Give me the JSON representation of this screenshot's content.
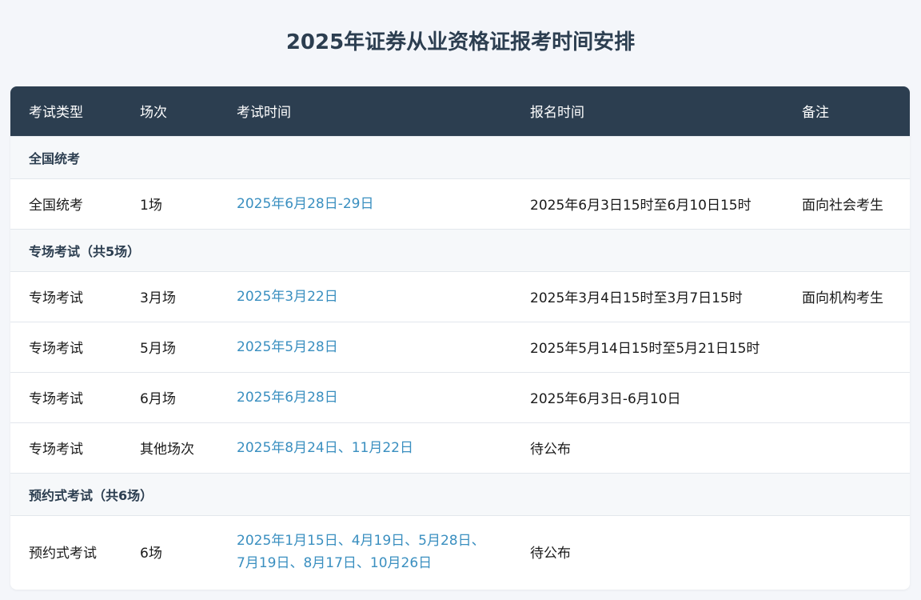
{
  "page": {
    "title": "2025年证券从业资格证报考时间安排"
  },
  "table": {
    "headers": [
      "考试类型",
      "场次",
      "考试时间",
      "报名时间",
      "备注"
    ],
    "groups": [
      {
        "label": "全国统考",
        "rows": [
          [
            "全国统考",
            "1场",
            "2025年6月28日-29日",
            "2025年6月3日15时至6月10日15时",
            "面向社会考生"
          ]
        ]
      },
      {
        "label": "专场考试（共5场）",
        "rows": [
          [
            "专场考试",
            "3月场",
            "2025年3月22日",
            "2025年3月4日15时至3月7日15时",
            "面向机构考生"
          ],
          [
            "专场考试",
            "5月场",
            "2025年5月28日",
            "2025年5月14日15时至5月21日15时",
            ""
          ],
          [
            "专场考试",
            "6月场",
            "2025年6月28日",
            "2025年6月3日-6月10日",
            ""
          ],
          [
            "专场考试",
            "其他场次",
            "2025年8月24日、11月22日",
            "待公布",
            ""
          ]
        ]
      },
      {
        "label": "预约式考试（共6场）",
        "rows": [
          [
            "预约式考试",
            "6场",
            [
              "2025年1月15日、4月19日、5月28日、",
              "7月19日、8月17日、10月26日"
            ],
            "待公布",
            ""
          ]
        ]
      }
    ]
  },
  "colors": {
    "header_bg": "#2c3e50",
    "title": "#2c3e50",
    "date_link": "#3a8fc0",
    "group_bg": "#f6f8fa",
    "page_bg": "#f4f6fa"
  }
}
